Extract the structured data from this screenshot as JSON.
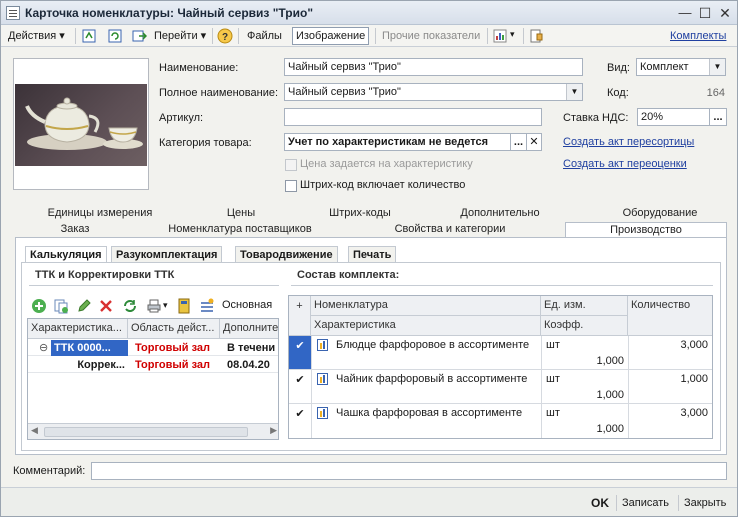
{
  "window": {
    "title": "Карточка номенклатуры: Чайный сервиз \"Трио\""
  },
  "toolbar": {
    "actions": "Действия",
    "goto": "Перейти",
    "files": "Файлы",
    "image": "Изображение",
    "other": "Прочие показатели",
    "kits": "Комплекты",
    "dropdown_arrow": "▾"
  },
  "form": {
    "name_label": "Наименование:",
    "name_value": "Чайный сервиз \"Трио\"",
    "fullname_label": "Полное наименование:",
    "fullname_value": "Чайный сервиз \"Трио\"",
    "article_label": "Артикул:",
    "article_value": "",
    "category_label": "Категория товара:",
    "category_value": "Учет по характеристикам не ведется",
    "price_by_char": "Цена задается на характеристику",
    "barcode_qty": "Штрих-код включает количество",
    "kind_label": "Вид:",
    "kind_value": "Комплект",
    "code_label": "Код:",
    "code_value": "164",
    "vat_label": "Ставка НДС:",
    "vat_value": "20%",
    "link_regrading": "Создать акт пересортицы",
    "link_revaluation": "Создать акт переоценки",
    "ellipsis": "...",
    "clear": "✕"
  },
  "tabs_row1": [
    "Единицы измерения",
    "Цены",
    "Штрих-коды",
    "Дополнительно",
    "Оборудование"
  ],
  "tabs_row2": [
    "Заказ",
    "Номенклатура поставщиков",
    "Свойства и категории",
    "Производство"
  ],
  "subtabs": [
    "Калькуляция",
    "Разукомплектация",
    "Товародвижение",
    "Печать"
  ],
  "left": {
    "title": "ТТК и Корректировки ТТК",
    "basic": "Основная",
    "headers": [
      "Характеристика...",
      "Область дейст...",
      "Дополните"
    ],
    "rows": [
      {
        "expander": "⊖",
        "c1": "ТТК 0000...",
        "c2": "Торговый зал",
        "c3": "В течени"
      },
      {
        "expander": "",
        "c1": "Коррек...",
        "c2": "Торговый зал",
        "c3": "08.04.20"
      }
    ]
  },
  "right": {
    "title": "Состав комплекта:",
    "headers": {
      "plus": "+",
      "nom": "Номенклатура",
      "char": "Характеристика",
      "unit": "Ед. изм.",
      "coef": "Коэфф.",
      "qty": "Количество"
    },
    "rows": [
      {
        "check": "✔",
        "name": "Блюдце фарфоровое в ассортименте",
        "unit": "шт",
        "coef": "1,000",
        "qty": "3,000"
      },
      {
        "check": "✔",
        "name": "Чайник фарфоровый в ассортименте",
        "unit": "шт",
        "coef": "1,000",
        "qty": "1,000"
      },
      {
        "check": "✔",
        "name": "Чашка фарфоровая в ассортименте",
        "unit": "шт",
        "coef": "1,000",
        "qty": "3,000"
      }
    ]
  },
  "comment": {
    "label": "Комментарий:",
    "value": ""
  },
  "footer": {
    "ok": "OK",
    "save": "Записать",
    "close": "Закрыть"
  },
  "colors": {
    "accent": "#3166c5",
    "link": "#2040a0",
    "red": "#d00000"
  }
}
